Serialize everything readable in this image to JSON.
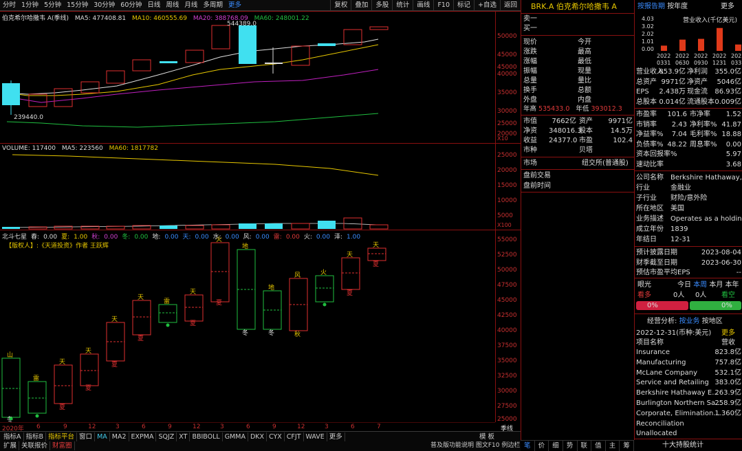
{
  "toolbar": {
    "periods": [
      "分时",
      "1分钟",
      "5分钟",
      "15分钟",
      "30分钟",
      "60分钟",
      "日线",
      "周线",
      "月线",
      "多周期",
      "更多"
    ],
    "active_period": "季线",
    "tools": [
      "复权",
      "叠加",
      "多股",
      "统计",
      "画线",
      "F10",
      "标记",
      "+自选",
      "返回"
    ]
  },
  "main_chart": {
    "title": "伯克希尔哈撒韦 A(季线)",
    "ma5": "MA5: 477408.81",
    "ma10": "MA10: 460555.69",
    "ma20": "MA20: 388768.09",
    "ma60": "MA60: 248001.22",
    "high_label": "544389.0",
    "low_label": "239440.0",
    "scale": "X10",
    "y_labels": [
      "50000",
      "45000",
      "40000",
      "35000",
      "30000",
      "25000",
      "20000"
    ]
  },
  "volume_chart": {
    "vol": "VOLUME: 117400",
    "ma5": "MA5: 223560",
    "ma60": "MA60: 1817782",
    "scale": "X100",
    "y_labels": [
      "25000",
      "20000",
      "15000",
      "10000",
      "5000"
    ]
  },
  "indicator_chart": {
    "name": "北斗七星",
    "items": [
      {
        "k": "春:",
        "v": "0.00"
      },
      {
        "k": "夏:",
        "v": "1.00"
      },
      {
        "k": "秋:",
        "v": "0.00"
      },
      {
        "k": "冬:",
        "v": "0.00"
      },
      {
        "k": "地:",
        "v": "0.00"
      },
      {
        "k": "天:",
        "v": "0.00"
      },
      {
        "k": "水:",
        "v": "0.00"
      },
      {
        "k": "风:",
        "v": "0.00"
      },
      {
        "k": "雷:",
        "v": "0.00"
      },
      {
        "k": "火:",
        "v": "0.00"
      },
      {
        "k": "泽:",
        "v": "1.00"
      }
    ],
    "author": "【版权人】:《天道投资》作者 王跃辉",
    "y_labels": [
      "55000",
      "52500",
      "50000",
      "47500",
      "45000",
      "42500",
      "40000",
      "37500",
      "35000",
      "32500",
      "30000",
      "27500",
      "25000"
    ],
    "x_labels": [
      "2020年",
      "6",
      "9",
      "12",
      "3",
      "6",
      "9",
      "12",
      "3",
      "6",
      "9",
      "12",
      "3",
      "6",
      "7"
    ],
    "jixian": "季线"
  },
  "bottom_tabs": {
    "row1": [
      "指标A",
      "指标B",
      "指标平台",
      "窗口",
      "MA",
      "MA2",
      "EXPMA",
      "SQJZ",
      "XT",
      "BBIBOLL",
      "GMMA",
      "DKX",
      "CYX",
      "CFJT",
      "WAVE",
      "更多"
    ],
    "row2": [
      "扩展",
      "关联报价",
      "财富圈"
    ],
    "row1_right": [
      "模",
      "板"
    ],
    "status_right": "普及版功能说明 图文F10 例边栏"
  },
  "quote": {
    "symbol": "BRK.A",
    "name": "伯克希尔哈撒韦 A",
    "sell1": "卖一",
    "buy1": "买一",
    "fields": [
      [
        "现价",
        "",
        "今开",
        ""
      ],
      [
        "涨跌",
        "",
        "最高",
        ""
      ],
      [
        "涨幅",
        "",
        "最低",
        ""
      ],
      [
        "振幅",
        "",
        "现量",
        ""
      ],
      [
        "总量",
        "",
        "量比",
        ""
      ],
      [
        "换手",
        "",
        "总额",
        ""
      ],
      [
        "外盘",
        "",
        "内盘",
        ""
      ]
    ],
    "high_label": "年高",
    "high_val": "535433.0",
    "low_label": "年低",
    "low_val": "393012.3",
    "stats": [
      [
        "市值",
        "7662亿",
        "资产",
        "9971亿"
      ],
      [
        "净资",
        "348016.3",
        "股本",
        "14.5万"
      ],
      [
        "收益",
        "24377.0",
        "市盈",
        "102.4"
      ],
      [
        "市种",
        "",
        "贝塔",
        ""
      ]
    ],
    "market_label": "市场",
    "market_val": "纽交所(普通股)",
    "premarket": "盘前交易",
    "premarket_time": "盘前时间"
  },
  "f10": {
    "tabs": [
      "按报告期",
      "按年度"
    ],
    "more": "更多",
    "chart_data": {
      "type": "bar",
      "title": "营业收入(千亿美元)",
      "ylim": [
        0,
        4.03
      ],
      "y_ticks": [
        "4.03",
        "3.02",
        "2.02",
        "1.01",
        "0.00"
      ],
      "categories": [
        "2022 0331",
        "2022 0630",
        "2022 0930",
        "2022 1231",
        "2023 0331"
      ],
      "values": [
        0.7,
        1.5,
        1.6,
        3.05,
        0.85
      ],
      "color": "#e03a1a"
    },
    "fin": [
      [
        "营业收入",
        "853.9亿",
        "净利润",
        "355.0亿"
      ],
      [
        "总资产",
        "9971亿",
        "净资产",
        "5046亿"
      ],
      [
        "EPS",
        "2.438万",
        "现金流",
        "86.93亿"
      ],
      [
        "总股本",
        "0.014亿",
        "流通股本",
        "0.009亿"
      ]
    ],
    "ratios": [
      [
        "市盈率",
        "101.6",
        "市净率",
        "1.52"
      ],
      [
        "市销率",
        "2.43",
        "净利率%",
        "41.87"
      ],
      [
        "净益率%",
        "7.04",
        "毛利率%",
        "18.88"
      ],
      [
        "负债率%",
        "48.22",
        "周息率%",
        "0.00"
      ]
    ],
    "ratio_single": [
      [
        "资本回报率%",
        "5.97"
      ],
      [
        "速动比率",
        "3.68"
      ]
    ],
    "company": [
      [
        "公司名称",
        "Berkshire Hathaway,..."
      ],
      [
        "行业",
        "金融业"
      ],
      [
        "子行业",
        "财险/意外险"
      ],
      [
        "所在地区",
        "美国"
      ],
      [
        "业务描述",
        "Operates as a holdin..."
      ],
      [
        "成立年份",
        "1839"
      ],
      [
        "年结日",
        "12-31"
      ]
    ],
    "dates": [
      [
        "预计披露日期",
        "2023-08-04"
      ],
      [
        "财季截至日期",
        "2023-06-30"
      ],
      [
        "预估市盈平均EPS",
        "--"
      ]
    ],
    "eye": {
      "title": "眼光",
      "tabs": [
        "今日",
        "本周",
        "本月",
        "本年"
      ],
      "bull": "看多",
      "bull_n": "0人",
      "bear_n": "0人",
      "bear": "看空",
      "bull_pct": "0%",
      "bear_pct": "0%"
    },
    "biz": {
      "title": "经营分析:",
      "tabs": [
        "按业务",
        "按地区"
      ],
      "date": "2022-12-31(币种:美元)",
      "more": "更多",
      "col1": "项目名称",
      "col2": "营收",
      "items": [
        [
          "Insurance",
          "823.8亿"
        ],
        [
          "Manufacturing",
          "757.8亿"
        ],
        [
          "McLane Company",
          "532.1亿"
        ],
        [
          "Service and Retailing",
          "383.0亿"
        ],
        [
          "Berkshire Hathaway E...",
          "263.9亿"
        ],
        [
          "Burlington Northern Sa...",
          "258.9亿"
        ],
        [
          "Corporate, Elimination...",
          "1.360亿"
        ],
        [
          "Reconciliation",
          ""
        ],
        [
          "Unallocated",
          ""
        ]
      ]
    },
    "footer": "十大持股统计",
    "bottom_tabs": [
      "笔",
      "价",
      "细",
      "势",
      "联",
      "值",
      "主",
      "筹"
    ]
  }
}
